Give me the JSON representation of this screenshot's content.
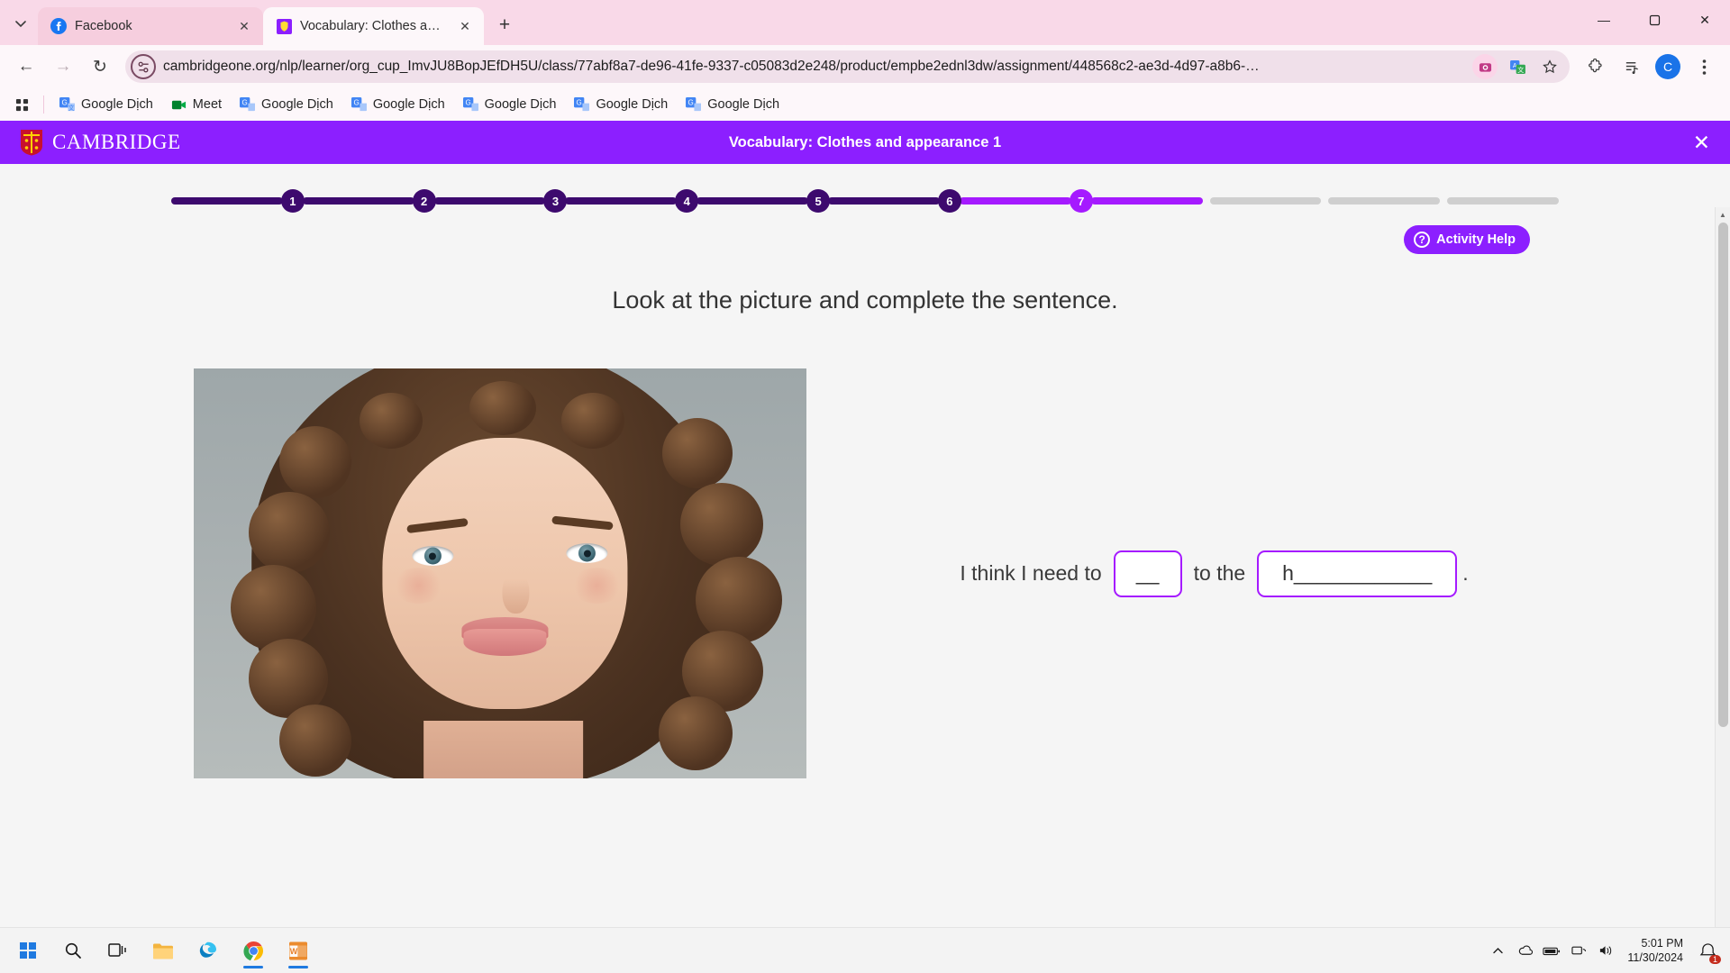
{
  "browser": {
    "tab_list_icon": "chevron-down-icon",
    "tabs": [
      {
        "title": "Facebook",
        "favicon": "facebook-icon",
        "active": false
      },
      {
        "title": "Vocabulary: Clothes and appeara",
        "favicon": "cambridge-icon",
        "active": true
      }
    ],
    "new_tab_label": "+",
    "window_controls": {
      "minimize": "—",
      "maximize": "❐",
      "close": "✕"
    },
    "nav": {
      "back": "←",
      "forward": "→",
      "reload": "↻"
    },
    "omnibox": {
      "site_chip_icon": "site-settings-icon",
      "url": "cambridgeone.org/nlp/learner/org_cup_ImvJU8BopJEfDH5U/class/77abf8a7-de96-41fe-9337-c05083d2e248/product/empbe2ednl3dw/assignment/448568c2-ae3d-4d97-a8b6-…",
      "lens_icon": "google-lens-icon",
      "translate_icon": "translate-icon",
      "bookmark_icon": "star-icon"
    },
    "toolbar_right": {
      "extensions_icon": "extensions-puzzle-icon",
      "media_icon": "media-playlist-icon",
      "profile_initial": "C",
      "menu_icon": "three-dot-menu-icon"
    },
    "bookmarks": {
      "apps_icon": "apps-grid-icon",
      "items": [
        {
          "label": "Google Dịch",
          "icon": "google-translate-icon"
        },
        {
          "label": "Meet",
          "icon": "google-meet-icon"
        },
        {
          "label": "Google Dịch",
          "icon": "google-translate-icon"
        },
        {
          "label": "Google Dịch",
          "icon": "google-translate-icon"
        },
        {
          "label": "Google Dịch",
          "icon": "google-translate-icon"
        },
        {
          "label": "Google Dịch",
          "icon": "google-translate-icon"
        },
        {
          "label": "Google Dịch",
          "icon": "google-translate-icon"
        }
      ]
    }
  },
  "app": {
    "brand": "CAMBRIDGE",
    "brand_crest_icon": "cambridge-crest-icon",
    "title": "Vocabulary: Clothes and appearance 1",
    "close_icon": "close-icon",
    "header_color": "#8c1fff"
  },
  "activity": {
    "stepper": {
      "steps": [
        {
          "label": "1",
          "state": "done"
        },
        {
          "label": "2",
          "state": "done"
        },
        {
          "label": "3",
          "state": "done"
        },
        {
          "label": "4",
          "state": "done"
        },
        {
          "label": "5",
          "state": "done"
        },
        {
          "label": "6",
          "state": "done"
        },
        {
          "label": "7",
          "state": "current"
        }
      ],
      "trailing_empty_segments": 3,
      "done_color": "#3d0a6e",
      "current_color": "#a51aff",
      "todo_color": "#cfcfcf"
    },
    "help_button": {
      "label": "Activity Help",
      "icon": "question-mark-icon"
    },
    "instruction": "Look at the picture and complete the sentence.",
    "image": {
      "alt": "Portrait of a woman with long curly brown hair"
    },
    "sentence": {
      "lead": "I think I need to",
      "blank1_value": "__",
      "middle": "to the",
      "blank2_value": "h____________",
      "trailing": ".",
      "blank_border_color": "#a51aff"
    },
    "scrollbar": {
      "up_arrow": "▲",
      "down_arrow": "▼"
    }
  },
  "taskbar": {
    "items": [
      {
        "name": "start-button",
        "icon": "windows-logo-icon",
        "active": false
      },
      {
        "name": "search-button",
        "icon": "search-icon",
        "active": false
      },
      {
        "name": "task-view-button",
        "icon": "task-view-icon",
        "active": false
      },
      {
        "name": "file-explorer-button",
        "icon": "folder-icon",
        "active": false
      },
      {
        "name": "edge-button",
        "icon": "edge-icon",
        "active": false
      },
      {
        "name": "chrome-button",
        "icon": "chrome-icon",
        "active": true
      },
      {
        "name": "word-button",
        "icon": "word-icon",
        "active": true
      }
    ],
    "tray": {
      "show_hidden_icon": "chevron-up-icon",
      "onedrive_icon": "onedrive-icon",
      "battery_icon": "battery-icon",
      "network_icon": "network-icon",
      "volume_icon": "volume-icon",
      "time": "5:01 PM",
      "date": "11/30/2024",
      "notification_icon": "notification-bell-icon",
      "notification_count": "1"
    }
  }
}
